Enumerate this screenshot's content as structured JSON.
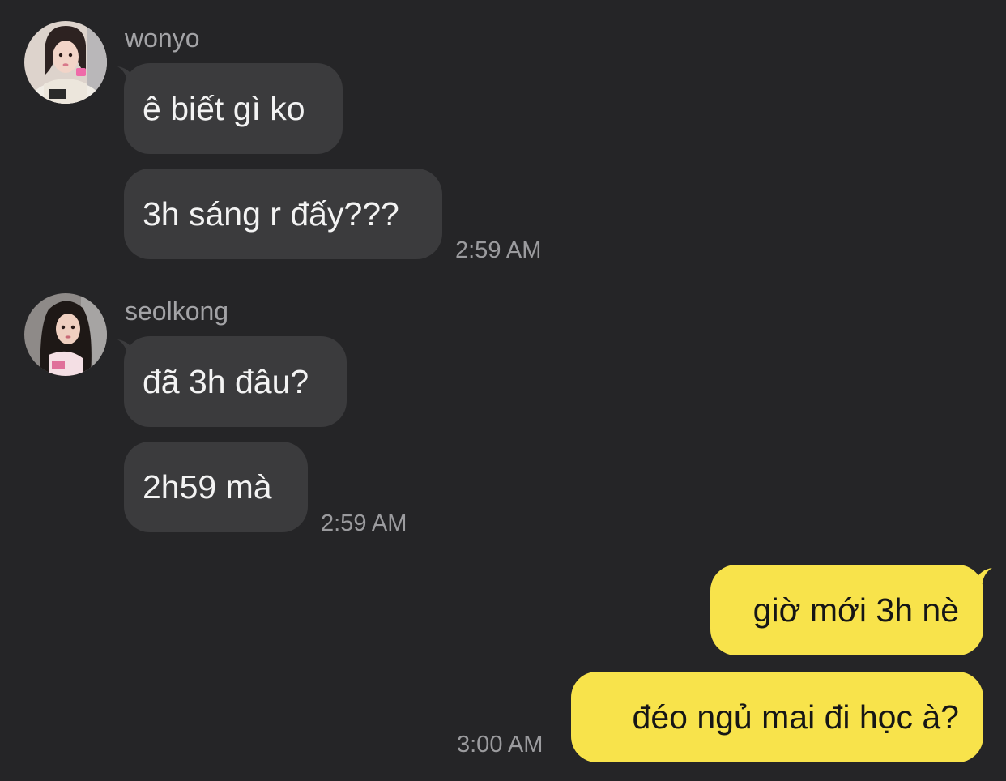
{
  "colors": {
    "background": "#252527",
    "incoming_bubble": "#3b3b3d",
    "outgoing_bubble": "#f8e34b",
    "name_text": "#a3a3a6",
    "timestamp_text": "#9b9b9e"
  },
  "groups": [
    {
      "sender": "wonyo",
      "avatar": "wonyo-avatar",
      "messages": [
        "ê biết gì ko",
        "3h sáng r đấy???"
      ],
      "time": "2:59 AM"
    },
    {
      "sender": "seolkong",
      "avatar": "seolkong-avatar",
      "messages": [
        "đã 3h đâu?",
        "2h59 mà"
      ],
      "time": "2:59 AM"
    },
    {
      "sender": "me",
      "messages": [
        "giờ mới 3h nè",
        "đéo ngủ mai đi học à?"
      ],
      "time": "3:00 AM"
    }
  ]
}
